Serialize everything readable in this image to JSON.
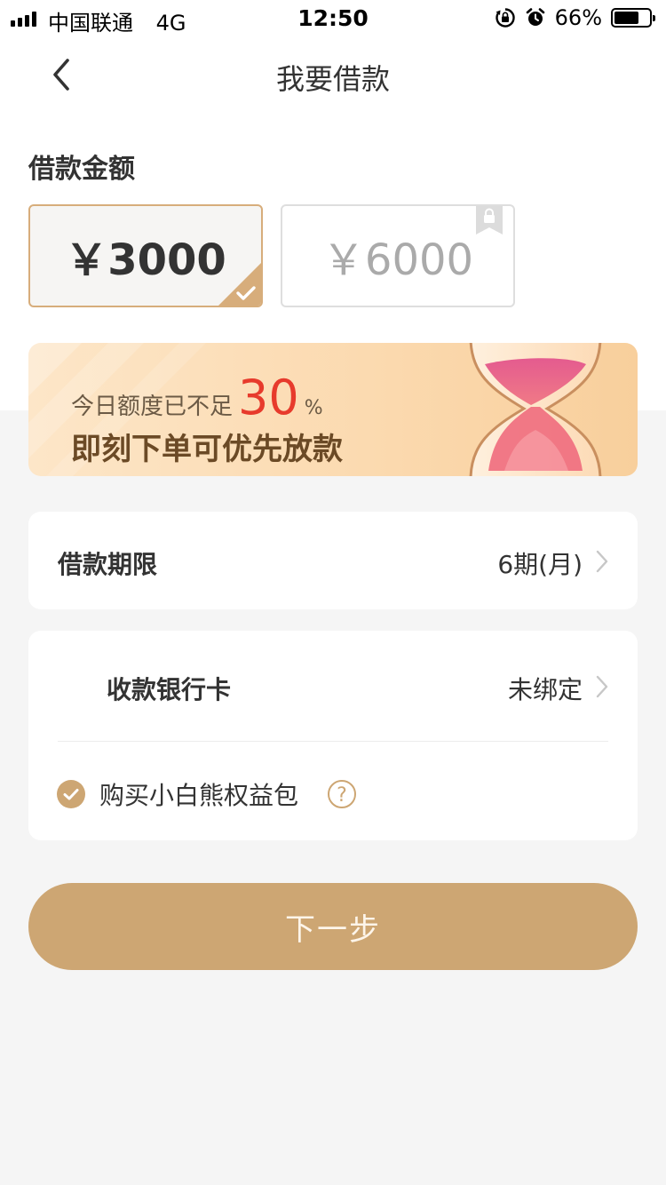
{
  "status_bar": {
    "carrier": "中国联通",
    "network": "4G",
    "time": "12:50",
    "battery": "66%",
    "battery_level": 0.66
  },
  "nav": {
    "title": "我要借款",
    "back_icon": "chevron-left-icon"
  },
  "amount_section": {
    "label": "借款金额",
    "options": [
      {
        "label": "￥3000",
        "selected": true,
        "locked": false
      },
      {
        "label": "￥6000",
        "selected": false,
        "locked": true
      }
    ]
  },
  "banner": {
    "line1_prefix": "今日额度已不足",
    "percent": "30",
    "percent_sign": "%",
    "line2": "即刻下单可优先放款"
  },
  "term": {
    "label": "借款期限",
    "value": "6期(月)"
  },
  "bank_card": {
    "label": "收款银行卡",
    "value": "未绑定"
  },
  "benefit": {
    "label": "购买小白熊权益包",
    "checked": true,
    "help_icon": "question-circle-icon"
  },
  "next_button": {
    "label": "下一步"
  },
  "colors": {
    "accent": "#cda673",
    "highlight": "#e73a2c",
    "selected_border": "#d7ad7b"
  }
}
